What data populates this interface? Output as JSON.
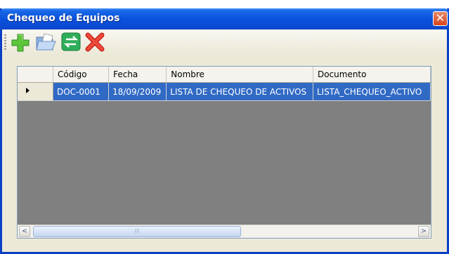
{
  "window": {
    "title": "Chequeo de Equipos",
    "close_symbol": "✕"
  },
  "toolbar": {
    "buttons": [
      "add-icon",
      "open-folder-icon",
      "transfer-icon",
      "delete-icon"
    ]
  },
  "grid": {
    "columns": [
      "Código",
      "Fecha",
      "Nombre",
      "Documento"
    ],
    "rows": [
      {
        "selected": true,
        "cells": [
          "DOC-0001",
          "18/09/2009",
          "LISTA DE CHEQUEO DE ACTIVOS",
          "LISTA_CHEQUEO_ACTIVO"
        ]
      }
    ]
  },
  "scrollbar": {
    "grip": "III",
    "left_arrow": "<",
    "right_arrow": ">"
  },
  "colors": {
    "selection": "#316ac5",
    "grid_background": "#808080",
    "titlebar": "#0a52dd"
  }
}
